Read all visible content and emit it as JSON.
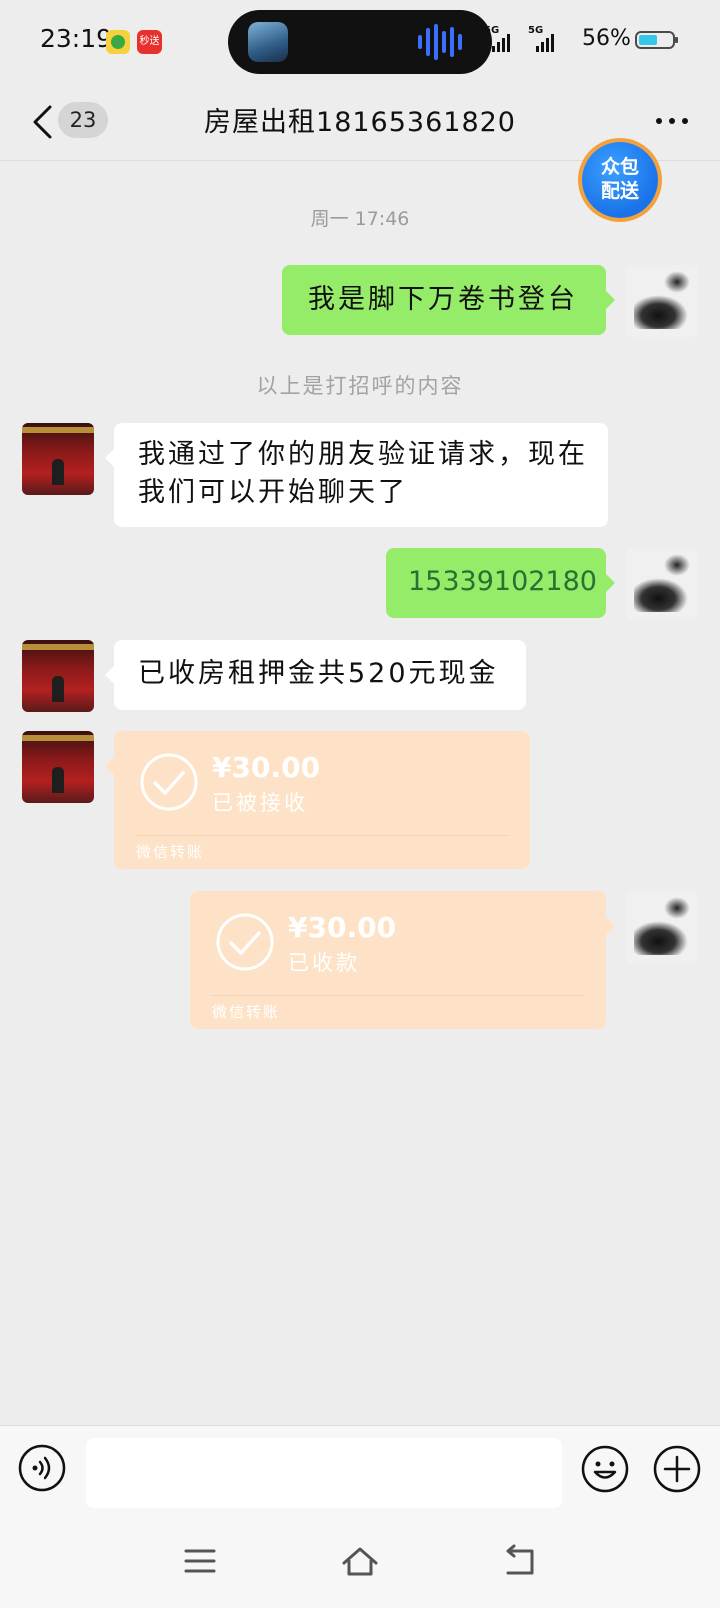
{
  "status_bar": {
    "time": "23:19",
    "badge_label": "秒送",
    "network_1": "5G",
    "network_2": "5G",
    "battery": "56%"
  },
  "header": {
    "unread_count": "23",
    "title": "房屋出租18165361820"
  },
  "float_badge": {
    "line1": "众包",
    "line2": "配送"
  },
  "messages": {
    "timestamp": "周一 17:46",
    "m1_text": "我是脚下万卷书登台",
    "system_note": "以上是打招呼的内容",
    "m2_line1": "我通过了你的朋友验证请求，现在",
    "m2_line2": "我们可以开始聊天了",
    "m3_text": "15339102180",
    "m4_text": "已收房租押金共520元现金",
    "t1": {
      "amount": "¥30.00",
      "status": "已被接收",
      "label": "微信转账"
    },
    "t2": {
      "amount": "¥30.00",
      "status": "已收款",
      "label": "微信转账"
    }
  },
  "colors": {
    "self_bubble": "#95ec69",
    "other_bubble": "#ffffff",
    "transfer_bg": "#fde2c7",
    "background": "#ededed"
  }
}
